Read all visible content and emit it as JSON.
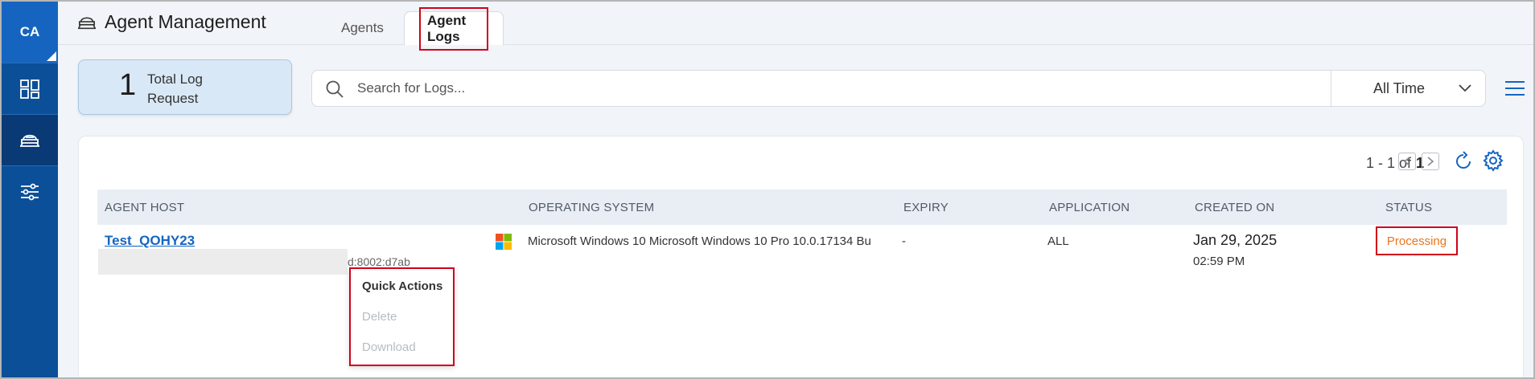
{
  "sidebar": {
    "avatar": "CA",
    "items": [
      {
        "icon": "dashboard-icon"
      },
      {
        "icon": "agent-icon",
        "active": true
      },
      {
        "icon": "sliders-icon"
      }
    ]
  },
  "header": {
    "title": "Agent Management",
    "tabs": [
      {
        "label": "Agents",
        "active": false
      },
      {
        "label": "Agent Logs",
        "active": true
      }
    ]
  },
  "summary": {
    "count": "1",
    "label": "Total Log Request"
  },
  "search": {
    "placeholder": "Search for Logs...",
    "value": ""
  },
  "filter": {
    "time_range": "All Time"
  },
  "pagination": {
    "range": "1 - 1 of",
    "total": "1"
  },
  "table": {
    "columns": [
      "AGENT HOST",
      "OPERATING SYSTEM",
      "EXPIRY",
      "APPLICATION",
      "CREATED ON",
      "STATUS"
    ],
    "rows": [
      {
        "host": "Test_QOHY23",
        "host_id_partial": "d:8002:d7ab",
        "os": "Microsoft Windows 10 Microsoft Windows 10 Pro 10.0.17134 Bu",
        "expiry": "-",
        "application": "ALL",
        "created_date": "Jan 29, 2025",
        "created_time": "02:59 PM",
        "status": "Processing"
      }
    ]
  },
  "quick_actions": {
    "title": "Quick Actions",
    "items": [
      "Delete",
      "Download"
    ]
  },
  "colors": {
    "sidebar": "#0b4f99",
    "link": "#1565c0",
    "status_processing": "#e8761b",
    "highlight": "#d0021b"
  }
}
